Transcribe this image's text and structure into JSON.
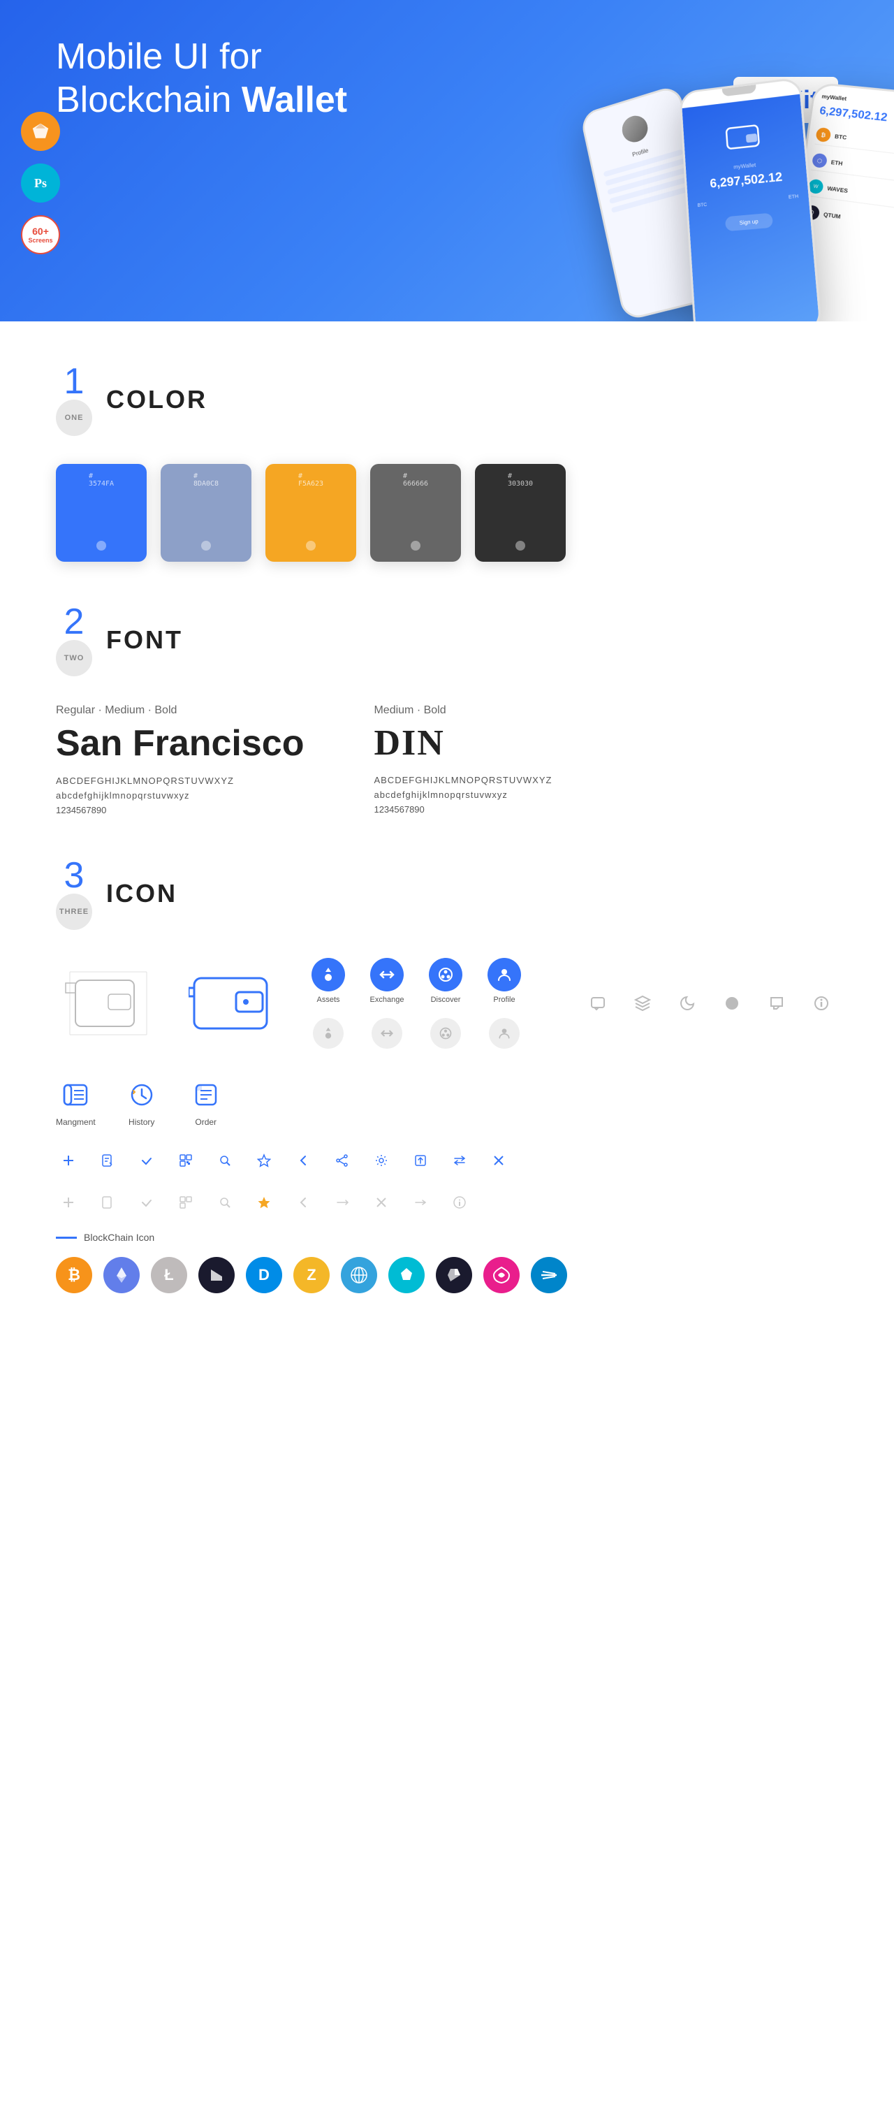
{
  "hero": {
    "title_part1": "Mobile UI for Blockchain ",
    "title_bold": "Wallet",
    "badge": "UI Kit",
    "badge_sketch": "S",
    "badge_ps": "Ps",
    "badge_screens_top": "60+",
    "badge_screens_bottom": "Screens"
  },
  "sections": {
    "color": {
      "number": "1",
      "label": "ONE",
      "title": "COLOR",
      "swatches": [
        {
          "hex": "#3574FA",
          "label": "#\n3574FA",
          "display_name": "3574FA"
        },
        {
          "hex": "#8DA0C8",
          "label": "#\n8DA0C8",
          "display_name": "8DA0C8"
        },
        {
          "hex": "#F5A623",
          "label": "#\nF5A623",
          "display_name": "F5A623"
        },
        {
          "hex": "#666666",
          "label": "#\n666666",
          "display_name": "666666"
        },
        {
          "hex": "#303030",
          "label": "#\n303030",
          "display_name": "303030"
        }
      ]
    },
    "font": {
      "number": "2",
      "label": "TWO",
      "title": "FONT",
      "fonts": [
        {
          "weights": "Regular · Medium · Bold",
          "name": "San Francisco",
          "uppercase": "ABCDEFGHIJKLMNOPQRSTUVWXYZ",
          "lowercase": "abcdefghijklmnopqrstuvwxyz",
          "numbers": "1234567890"
        },
        {
          "weights": "Medium · Bold",
          "name": "DIN",
          "uppercase": "ABCDEFGHIJKLMNOPQRSTUVWXYZ",
          "lowercase": "abcdefghijklmnopqrstuvwxyz",
          "numbers": "1234567890"
        }
      ]
    },
    "icon": {
      "number": "3",
      "label": "THREE",
      "title": "ICON",
      "nav_icons": [
        {
          "label": "Assets"
        },
        {
          "label": "Exchange"
        },
        {
          "label": "Discover"
        },
        {
          "label": "Profile"
        }
      ],
      "mgmt_icons": [
        {
          "label": "Mangment"
        },
        {
          "label": "History"
        },
        {
          "label": "Order"
        }
      ],
      "blockchain_label": "BlockChain Icon",
      "crypto_coins": [
        {
          "symbol": "₿",
          "color": "#f7931a",
          "name": "bitcoin"
        },
        {
          "symbol": "⬡",
          "color": "#627eea",
          "name": "ethereum"
        },
        {
          "symbol": "Ł",
          "color": "#bfbbbb",
          "name": "litecoin"
        },
        {
          "symbol": "◆",
          "color": "#1a1a2e",
          "name": "neo"
        },
        {
          "symbol": "D",
          "color": "#008ce7",
          "name": "dash"
        },
        {
          "symbol": "Z",
          "color": "#f4b728",
          "name": "zcash"
        },
        {
          "symbol": "◈",
          "color": "#34a3dd",
          "name": "lattice"
        },
        {
          "symbol": "▲",
          "color": "#00bcd4",
          "name": "ark"
        },
        {
          "symbol": "◇",
          "color": "#1a1a2e",
          "name": "stratis"
        },
        {
          "symbol": "∞",
          "color": "#e91e8c",
          "name": "polkadot"
        },
        {
          "symbol": "⚡",
          "color": "#0085ca",
          "name": "stellar"
        }
      ]
    }
  }
}
